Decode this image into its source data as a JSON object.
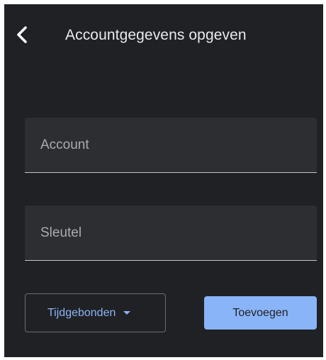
{
  "header": {
    "title": "Accountgegevens opgeven",
    "back_icon": "chevron-left-icon"
  },
  "form": {
    "account": {
      "placeholder": "Account",
      "value": ""
    },
    "key": {
      "placeholder": "Sleutel",
      "value": ""
    },
    "key_type": {
      "selected": "Tijdgebonden",
      "icon": "caret-down-icon"
    },
    "add_label": "Toevoegen"
  },
  "colors": {
    "background": "#202124",
    "field_background": "#2d2e31",
    "accent": "#8ab4f8",
    "text": "#e8eaed"
  }
}
